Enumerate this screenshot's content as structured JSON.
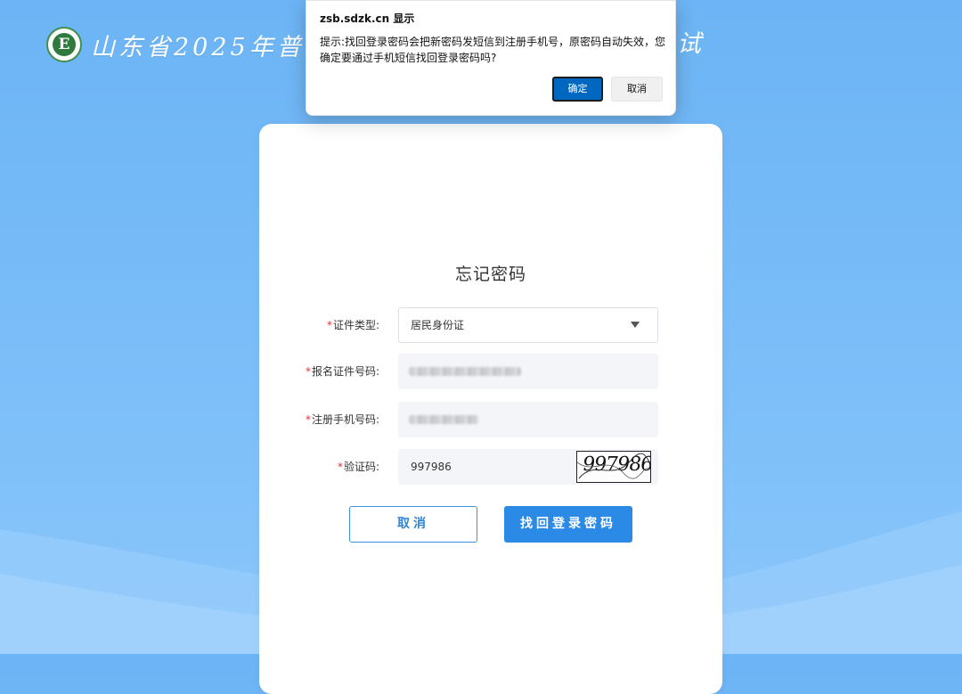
{
  "header": {
    "title": "山东省2025年普",
    "title_end": "试"
  },
  "form": {
    "title": "忘记密码",
    "required_mark": "*",
    "fields": [
      {
        "label": "证件类型:",
        "value": "居民身份证"
      },
      {
        "label": "报名证件号码:",
        "value": ""
      },
      {
        "label": "注册手机号码:",
        "value": ""
      },
      {
        "label": "验证码:",
        "value": "997986"
      }
    ],
    "captcha_text": "997986",
    "cancel_label": "取消",
    "submit_label": "找回登录密码"
  },
  "dialog": {
    "title": "zsb.sdzk.cn 显示",
    "message": "提示:找回登录密码会把新密码发短信到注册手机号，原密码自动失效，您确定要通过手机短信找回登录密码吗?",
    "ok_label": "确定",
    "cancel_label": "取消"
  },
  "colors": {
    "accent": "#2a8ae6",
    "dialog_ok": "#0067c0",
    "required": "#e03131"
  }
}
